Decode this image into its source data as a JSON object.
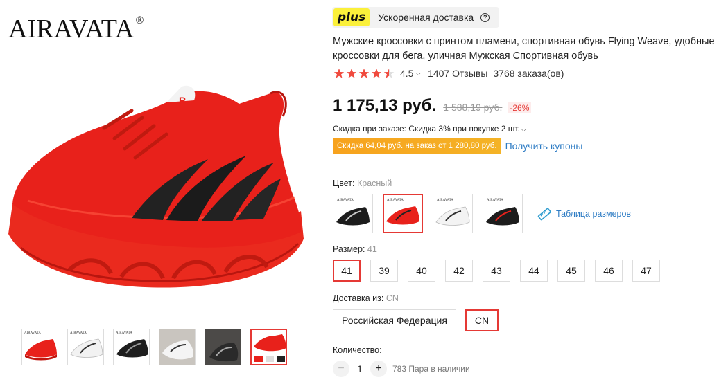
{
  "brand": {
    "name": "AIRAVATA",
    "mark": "®"
  },
  "thumbnails": [
    {
      "color": "#e8211b",
      "logo": "AIRAVATA"
    },
    {
      "color": "#f2f2f2",
      "logo": "AIRAVATA"
    },
    {
      "color": "#1e1e1e",
      "logo": "AIRAVATA"
    },
    {
      "color": "#c9c5bf",
      "logo": ""
    },
    {
      "color": "#4c4a48",
      "logo": ""
    },
    {
      "color": "#e8211b",
      "logo": ""
    }
  ],
  "thumbnails_active": 5,
  "plus": {
    "badge": "plus",
    "text": "Ускоренная доставка",
    "help": "?"
  },
  "product": {
    "title": "Мужские кроссовки с принтом пламени, спортивная обувь Flying Weave, удобные кроссовки для бега, уличная Мужская Спортивная обувь",
    "rating": "4.5",
    "rating_value": 4.5,
    "reviews": "1407 Отзывы",
    "orders": "3768 заказа(ов)"
  },
  "price": {
    "current": "1 175,13 руб.",
    "old": "1 588,19 руб.",
    "discount": "-26%"
  },
  "bulk_discount": "Скидка при заказе: Скидка 3% при покупке 2 шт.",
  "coupon": {
    "badge": "Скидка 64,04 руб. на заказ от 1 280,80 руб.",
    "link": "Получить купоны"
  },
  "color": {
    "label": "Цвет:",
    "selected": "Красный",
    "options": [
      {
        "name": "black",
        "shoe": "#1c1c1c",
        "accent": "#c9c9c9"
      },
      {
        "name": "red",
        "shoe": "#e8211b",
        "accent": "#222222"
      },
      {
        "name": "white",
        "shoe": "#f3f3f3",
        "accent": "#333333"
      },
      {
        "name": "black-red",
        "shoe": "#1c1c1c",
        "accent": "#e8211b"
      }
    ],
    "active": 1,
    "size_table": "Таблица размеров"
  },
  "size": {
    "label": "Размер:",
    "selected": "41",
    "options": [
      "41",
      "39",
      "40",
      "42",
      "43",
      "44",
      "45",
      "46",
      "47"
    ],
    "active": 0
  },
  "shipping": {
    "label": "Доставка из:",
    "selected": "CN",
    "options": [
      "Российская Федерация",
      "CN"
    ],
    "active": 1
  },
  "quantity": {
    "label": "Количество:",
    "value": "1",
    "minus": "−",
    "plus": "+",
    "stock": "783 Пара в наличии"
  },
  "colors": {
    "accent": "#e53935",
    "link": "#2e7cc4",
    "star": "#f04a3e",
    "coupon": "#f7a21d",
    "plus_badge": "#fbf03b"
  },
  "icons": {
    "help": "question-circle-icon",
    "chevron": "chevron-down-icon",
    "ruler": "ruler-icon",
    "star": "star-icon"
  }
}
